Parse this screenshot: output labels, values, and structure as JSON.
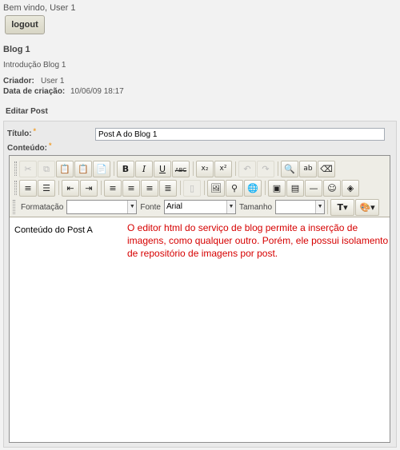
{
  "header": {
    "welcome": "Bem vindo, User 1",
    "logout_label": "logout"
  },
  "blog": {
    "title": "Blog 1",
    "intro": "Introdução Blog 1",
    "creator_label": "Criador:",
    "creator_value": "User 1",
    "created_label": "Data de criação:",
    "created_value": "10/06/09 18:17"
  },
  "form": {
    "section_title": "Editar Post",
    "title_label": "Título:",
    "title_value": "Post A do Blog 1",
    "content_label": "Conteúdo:",
    "required_mark": "*"
  },
  "toolbar": {
    "row1": [
      "cut-icon",
      "copy-icon",
      "paste-icon",
      "paste-text-icon",
      "paste-word-icon",
      "bold-icon",
      "italic-icon",
      "underline-icon",
      "strikethrough-icon",
      "subscript-icon",
      "superscript-icon",
      "undo-icon",
      "redo-icon",
      "find-icon",
      "replace-icon",
      "eraser-icon"
    ],
    "row2": [
      "numbered-list-icon",
      "bulleted-list-icon",
      "outdent-icon",
      "indent-icon",
      "align-left-icon",
      "align-center-icon",
      "align-right-icon",
      "justify-icon",
      "page-icon",
      "image-manager-icon",
      "find-replace-icon",
      "link-icon",
      "image-icon",
      "table-icon",
      "horizontal-rule-icon",
      "smiley-icon",
      "special-char-icon"
    ],
    "format_label": "Formatação",
    "format_value": "",
    "font_label": "Fonte",
    "font_value": "Arial",
    "size_label": "Tamanho",
    "size_value": ""
  },
  "editor": {
    "content": "Conteúdo do Post A"
  },
  "annotation": "O editor html do serviço de blog permite a inserção de imagens, como qualquer outro. Porém, ele possui isolamento de repositório de imagens por post.",
  "colors": {
    "annotation": "#d60000",
    "required": "#f0a030",
    "background": "#f2f2f2"
  }
}
